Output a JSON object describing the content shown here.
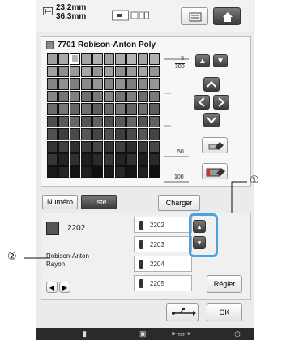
{
  "header": {
    "dim_width": "23.2mm",
    "dim_height": "36.3mm"
  },
  "thread": {
    "title": "7701 Robison-Anton Poly",
    "scale_fraction_num": "3",
    "scale_fraction_den": "300",
    "scale_mid": "50",
    "scale_bottom": "100"
  },
  "buttons": {
    "numero": "Numéro",
    "liste": "Liste",
    "charger": "Charger",
    "regler": "Régler",
    "ok": "OK"
  },
  "selected": {
    "code": "2202",
    "brand_line1": "Robison-Anton",
    "brand_line2": "Rayon"
  },
  "thread_list": [
    "2202",
    "2203",
    "2204",
    "2205"
  ],
  "callouts": {
    "one": "①",
    "two": "②"
  },
  "colors": {
    "accent": "#4aa3e0",
    "dark_button": "#3a3a3a"
  },
  "icons": [
    "dimension-icon",
    "preview-icon",
    "memory-icon",
    "home-icon",
    "up-arrow-icon",
    "down-arrow-icon",
    "left-arrow-icon",
    "right-arrow-icon",
    "eraser-icon",
    "usb-icon",
    "spool-icon"
  ]
}
